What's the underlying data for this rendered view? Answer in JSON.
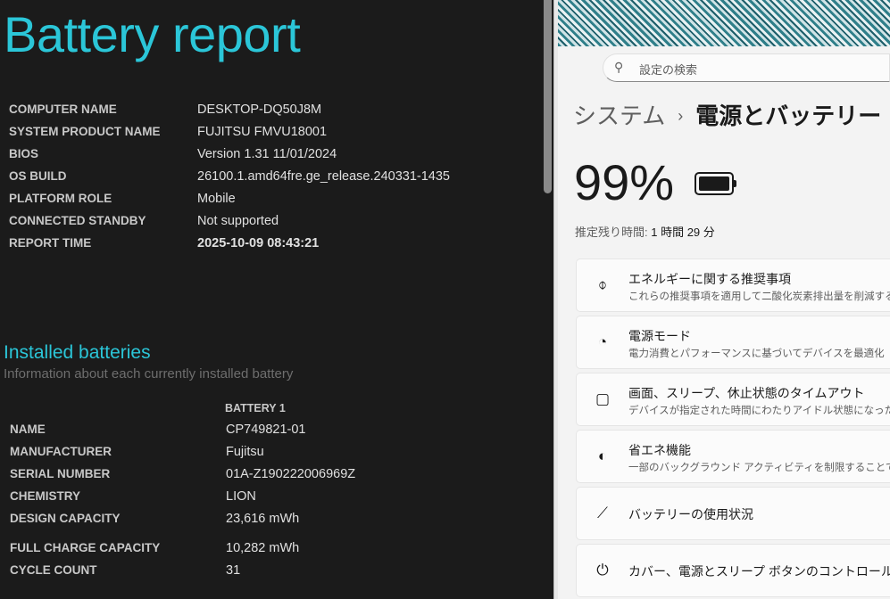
{
  "report": {
    "title": "Battery report",
    "system": [
      {
        "k": "COMPUTER NAME",
        "v": "DESKTOP-DQ50J8M"
      },
      {
        "k": "SYSTEM PRODUCT NAME",
        "v": "FUJITSU FMVU18001"
      },
      {
        "k": "BIOS",
        "v": "Version 1.31 11/01/2024"
      },
      {
        "k": "OS BUILD",
        "v": "26100.1.amd64fre.ge_release.240331-1435"
      },
      {
        "k": "PLATFORM ROLE",
        "v": "Mobile"
      },
      {
        "k": "CONNECTED STANDBY",
        "v": "Not supported"
      },
      {
        "k": "REPORT TIME",
        "v": "2025-10-09  08:43:21"
      }
    ],
    "installed_title": "Installed batteries",
    "installed_sub": "Information about each currently installed battery",
    "battery_header": "BATTERY 1",
    "battery": [
      {
        "k": "NAME",
        "v": "CP749821-01"
      },
      {
        "k": "MANUFACTURER",
        "v": "Fujitsu"
      },
      {
        "k": "SERIAL NUMBER",
        "v": "01A-Z190222006969Z"
      },
      {
        "k": "CHEMISTRY",
        "v": "LION"
      },
      {
        "k": "DESIGN CAPACITY",
        "v": "23,616 mWh"
      },
      {
        "k": "FULL CHARGE CAPACITY",
        "v": "10,282 mWh"
      },
      {
        "k": "CYCLE COUNT",
        "v": "31"
      }
    ]
  },
  "settings": {
    "search_placeholder": "設定の検索",
    "breadcrumb_parent": "システム",
    "breadcrumb_sep": "›",
    "breadcrumb_current": "電源とバッテリー",
    "percent": "99%",
    "percent_value": 99,
    "estimate_label": "推定残り時間:",
    "estimate_value": "1 時間 29 分",
    "cards": [
      {
        "icon": "leaf-icon",
        "glyph": "⌽",
        "title": "エネルギーに関する推奨事項",
        "desc": "これらの推奨事項を適用して二酸化炭素排出量を削減する"
      },
      {
        "icon": "gauge-icon",
        "glyph": "◔",
        "title": "電源モード",
        "desc": "電力消費とパフォーマンスに基づいてデバイスを最適化"
      },
      {
        "icon": "screen-sleep-icon",
        "glyph": "▢",
        "title": "画面、スリープ、休止状態のタイムアウト",
        "desc": "デバイスが指定された時間にわたりアイドル状態になった場合の動作"
      },
      {
        "icon": "battery-saver-icon",
        "glyph": "◐",
        "title": "省エネ機能",
        "desc": "一部のバックグラウンド アクティビティを制限することで、電力消費を抑える"
      },
      {
        "icon": "chart-icon",
        "glyph": "⟋",
        "title": "バッテリーの使用状況"
      },
      {
        "icon": "power-button-icon",
        "glyph": "⏻",
        "title": "カバー、電源とスリープ ボタンのコントロール"
      }
    ]
  }
}
